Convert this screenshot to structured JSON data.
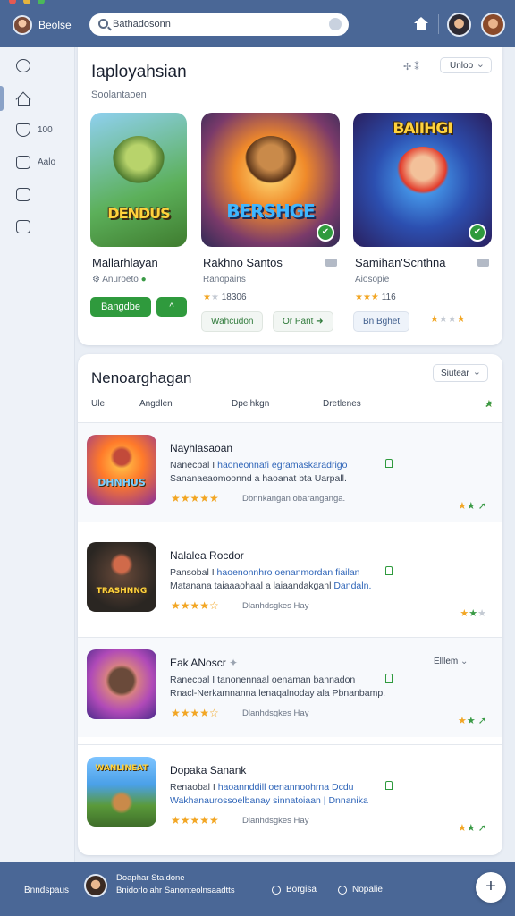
{
  "topbar": {
    "brand": "Beolse",
    "search_placeholder": "Bathadosonn"
  },
  "sidebar": {
    "items": [
      {
        "icon": "chat-icon",
        "label": ""
      },
      {
        "icon": "home-icon",
        "label": ""
      },
      {
        "icon": "shield-icon",
        "label": "100"
      },
      {
        "icon": "check-icon",
        "label": "Aalo"
      },
      {
        "icon": "message-icon",
        "label": ""
      },
      {
        "icon": "image-icon",
        "label": ""
      }
    ]
  },
  "featured": {
    "title": "Iaployahsian",
    "subtitle": "Soolantaoen",
    "controls_icon": "✢ ⁑",
    "filter_label": "Unloo",
    "games": [
      {
        "name": "Mallarhlayan",
        "meta": "Anuroeto",
        "install_label": "Bangdbe",
        "expand_label": "^",
        "logo": "DENDUS"
      },
      {
        "name": "Rakhno Santos",
        "meta": "Ranopains",
        "rating": "18306",
        "btn1": "Wahcudon",
        "btn2": "Or Pant",
        "logo": "BERSHGE"
      },
      {
        "name": "Samihan'Scnthna",
        "meta": "Aiosopie",
        "rating": "116",
        "btn1": "Bn Bghet",
        "logo": "BAIIHGI"
      }
    ]
  },
  "list": {
    "title": "Nenoarghagan",
    "sort_label": "Siutear",
    "tabs": [
      "Ule",
      "Angdlen",
      "Dpelhkgn",
      "Dretlenes"
    ],
    "rows": [
      {
        "title": "Nayhlasaoan",
        "line1a": "Nanecbal I ",
        "line1b": "haoneonnafi egramaskaradrigo",
        "line2a": "Sananaeaomoonnd a haoanat bta Uarpall.",
        "line2b": "",
        "sub": "Dbnnkangan obaranganga.",
        "logo": "DHNHUS"
      },
      {
        "title": "Nalalea Rocdor",
        "line1a": "Pansobal I ",
        "line1b": "haoenonnhro oenanmordan fiailan",
        "line2a": "Matanana taiaaaohaal a laiaandakganl ",
        "line2b": "Dandaln.",
        "sub": "Dlanhdsgkes Hay",
        "logo": "TRASHNNG"
      },
      {
        "title": "Eak ANoscr",
        "line1a": "Ranecbal I ",
        "line1b": "tanonennaal oenaman bannadon",
        "line2a": "Rnacl-Nerkamnanna lenaqalnoday ala Pbnanbamp.",
        "line2b": "",
        "sub": "Dlanhdsgkes Hay",
        "drop": "Elllem",
        "logo": ""
      },
      {
        "title": "Dopaka Sanank",
        "line1a": "Renaobal I ",
        "line1b": "haoannddill oenannoohrna Dcdu",
        "line2a": "",
        "line2b": "Wakhanaurossoelbanay sinnatoiaan | Dnnanika",
        "sub": "Dlanhdsgkes Hay",
        "logo": "WANLINEAT"
      }
    ]
  },
  "bottombar": {
    "left_label": "Bnndspaus",
    "user_name": "Doaphar Staldone",
    "user_desc": "Bnidorlo ahr Sanonteolnsaadtts",
    "link1": "Borgisa",
    "link2": "Nopalie",
    "fab_label": "+"
  },
  "colors": {
    "topbar": "#4a6796",
    "accent_green": "#2f9a3d",
    "star_orange": "#f2a624",
    "link_blue": "#2f65b8"
  }
}
